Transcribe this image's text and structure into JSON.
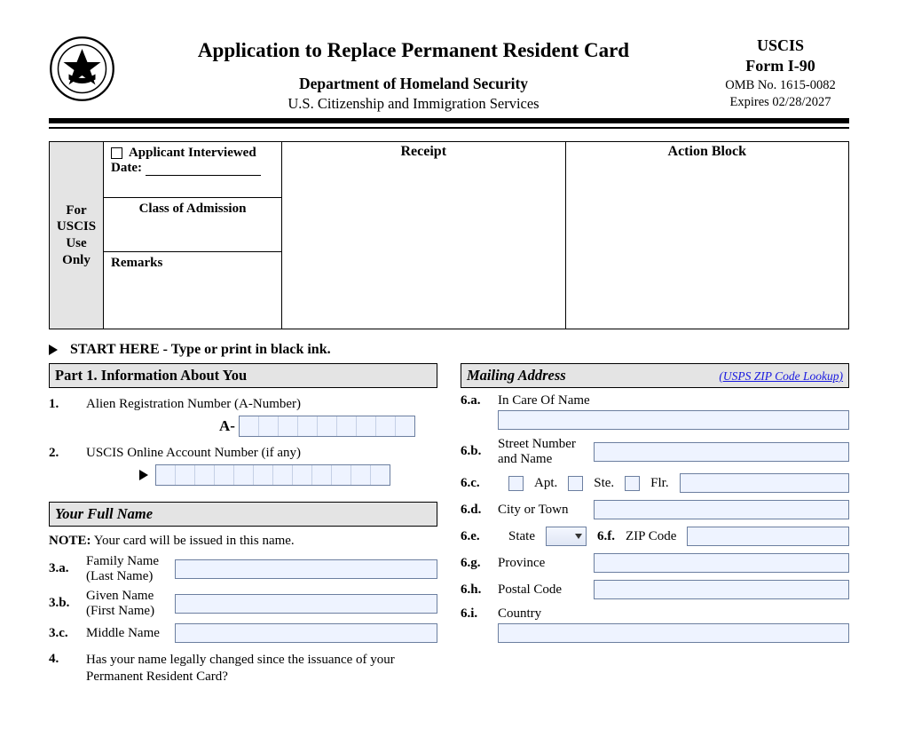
{
  "header": {
    "title": "Application to Replace Permanent Resident Card",
    "dept": "Department of Homeland Security",
    "agency": "U.S. Citizenship and Immigration Services",
    "uscis": "USCIS",
    "form": "Form I-90",
    "omb": "OMB No. 1615-0082",
    "expires": "Expires 02/28/2027"
  },
  "uscis_box": {
    "side": "For USCIS Use Only",
    "applicant_interviewed": "Applicant Interviewed",
    "date": "Date:",
    "class_of_admission": "Class of Admission",
    "remarks": "Remarks",
    "receipt": "Receipt",
    "action_block": "Action Block"
  },
  "start_here": "START HERE - Type or print in black ink.",
  "part1": {
    "title": "Part 1.  Information About You",
    "q1": "Alien Registration Number (A-Number)",
    "a_prefix": "A-",
    "q2": "USCIS Online Account Number (if any)",
    "your_full_name": "Your Full Name",
    "note": "Your card will be issued in this name.",
    "note_label": "NOTE:",
    "n3a_num": "3.a.",
    "n3a": "Family Name (Last Name)",
    "n3b_num": "3.b.",
    "n3b": "Given Name (First Name)",
    "n3c_num": "3.c.",
    "n3c": "Middle Name",
    "q4": "Has your name legally changed since the issuance of your Permanent Resident Card?"
  },
  "mailing": {
    "title": "Mailing Address",
    "usps_link": "(USPS ZIP Code Lookup)",
    "m6a_num": "6.a.",
    "m6a": "In Care Of Name",
    "m6b_num": "6.b.",
    "m6b": "Street Number and Name",
    "m6c_num": "6.c.",
    "apt": "Apt.",
    "ste": "Ste.",
    "flr": "Flr.",
    "m6d_num": "6.d.",
    "m6d": "City or Town",
    "m6e_num": "6.e.",
    "m6e": "State",
    "m6f_num": "6.f.",
    "m6f": "ZIP Code",
    "m6g_num": "6.g.",
    "m6g": "Province",
    "m6h_num": "6.h.",
    "m6h": "Postal Code",
    "m6i_num": "6.i.",
    "m6i": "Country"
  }
}
